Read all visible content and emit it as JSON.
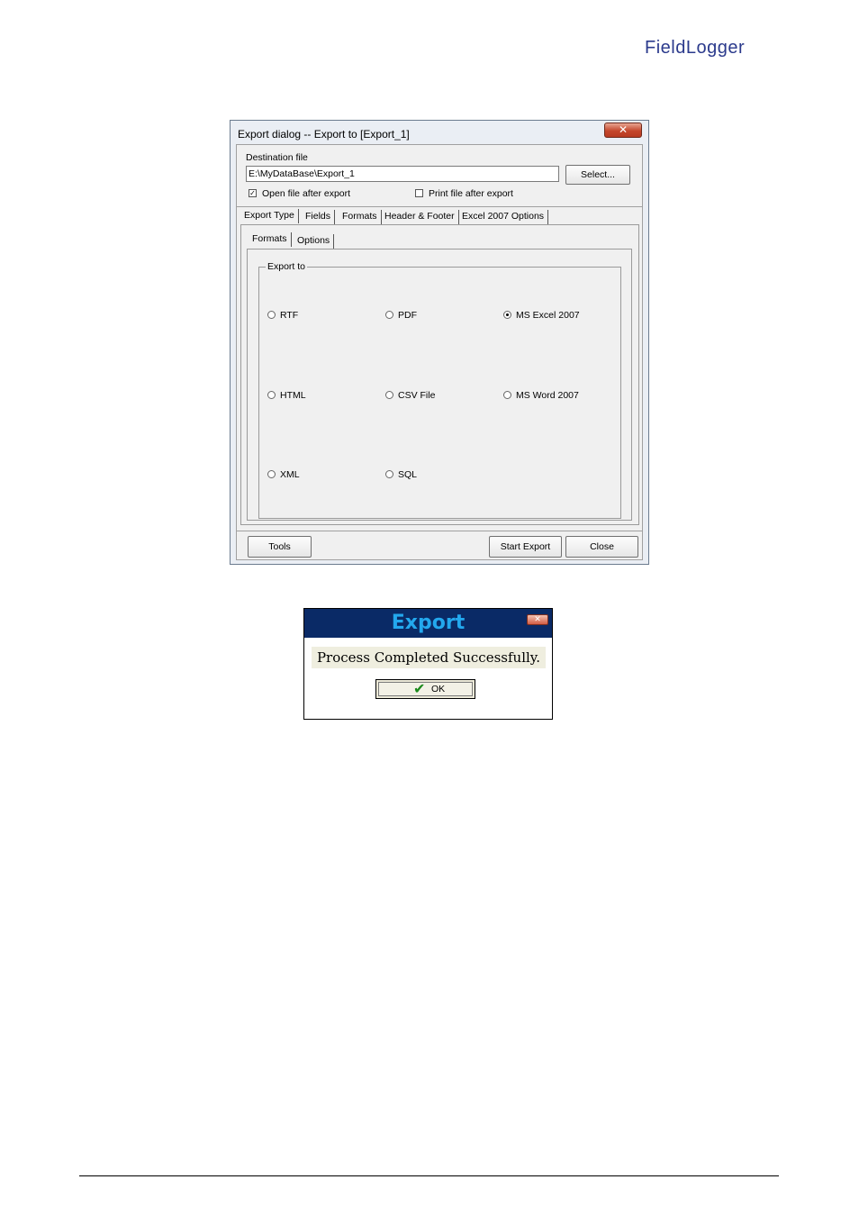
{
  "logo": {
    "text": "FieldLogger"
  },
  "export_dialog": {
    "title": "Export dialog -- Export to [Export_1]",
    "destination": {
      "label": "Destination file",
      "value": "E:\\MyDataBase\\Export_1",
      "select_button": "Select..."
    },
    "open_after_export": {
      "label": "Open file after export",
      "checked": true
    },
    "print_after_export": {
      "label": "Print file after export",
      "checked": false
    },
    "tabs": [
      "Export Type",
      "Fields",
      "Formats",
      "Header & Footer",
      "Excel 2007 Options"
    ],
    "subtabs": [
      "Formats",
      "Options"
    ],
    "group_label": "Export to",
    "formats": [
      {
        "label": "RTF",
        "selected": false
      },
      {
        "label": "PDF",
        "selected": false
      },
      {
        "label": "MS Excel 2007",
        "selected": true
      },
      {
        "label": "HTML",
        "selected": false
      },
      {
        "label": "CSV File",
        "selected": false
      },
      {
        "label": "MS Word 2007",
        "selected": false
      },
      {
        "label": "XML",
        "selected": false
      },
      {
        "label": "SQL",
        "selected": false
      }
    ],
    "buttons": {
      "tools": "Tools",
      "start_export": "Start Export",
      "close": "Close"
    }
  },
  "message_box": {
    "title": "Export",
    "text": "Process Completed Successfully.",
    "ok_label": "OK"
  }
}
